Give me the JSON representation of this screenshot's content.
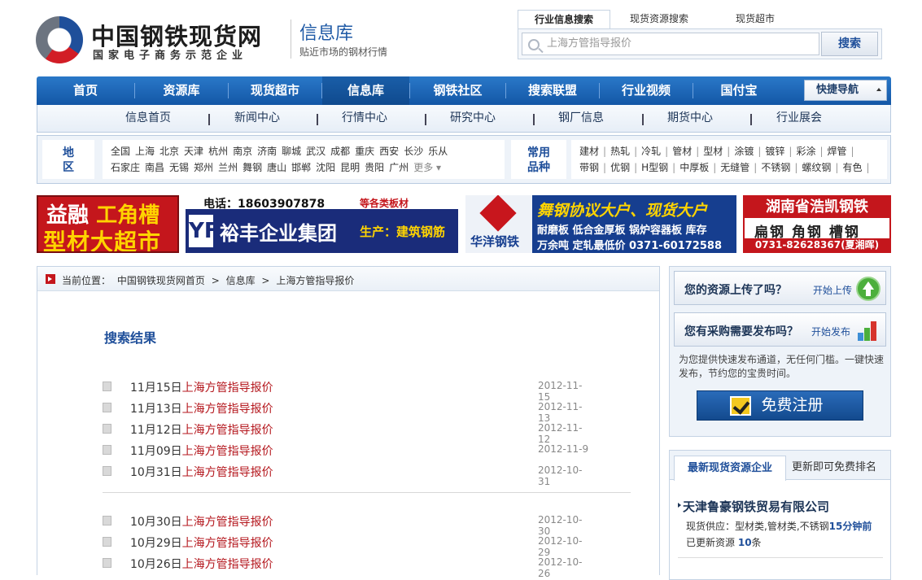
{
  "header": {
    "logo_main": "中国钢铁现货网",
    "logo_sub": "国家电子商务示范企业",
    "section_title": "信息库",
    "section_sub": "贴近市场的钢材行情",
    "search_tabs": [
      "行业信息搜索",
      "现货资源搜索",
      "现货超市"
    ],
    "search_placeholder": "上海方管指导报价",
    "search_button": "搜索"
  },
  "main_nav": {
    "items": [
      "首页",
      "资源库",
      "现货超市",
      "信息库",
      "钢铁社区",
      "搜索联盟",
      "行业视频",
      "国付宝"
    ],
    "active": "信息库",
    "quick_nav": "快捷导航"
  },
  "sub_nav": [
    "信息首页",
    "新闻中心",
    "行情中心",
    "研究中心",
    "钢厂信息",
    "期货中心",
    "行业展会"
  ],
  "filters": {
    "region_label": "地区",
    "regions_row1": [
      "全国",
      "上海",
      "北京",
      "天津",
      "杭州",
      "南京",
      "济南",
      "聊城",
      "武汉",
      "成都",
      "重庆",
      "西安",
      "长沙",
      "乐从"
    ],
    "regions_row2": [
      "石家庄",
      "南昌",
      "无锡",
      "郑州",
      "兰州",
      "舞钢",
      "唐山",
      "邯郸",
      "沈阳",
      "昆明",
      "贵阳",
      "广州"
    ],
    "more_label": "更多",
    "product_label": "常用品种",
    "products_row1": [
      "建材",
      "热轧",
      "冷轧",
      "管材",
      "型材",
      "涂镀",
      "镀锌",
      "彩涂",
      "焊管"
    ],
    "products_row2": [
      "带钢",
      "优钢",
      "H型钢",
      "中厚板",
      "无缝管",
      "不锈钢",
      "螺纹钢",
      "有色"
    ]
  },
  "ads": {
    "ad1_l1a": "益融",
    "ad1_l1b": "工角槽",
    "ad1_l2": "型材大超市",
    "ad2_phone": "电话：18603907878",
    "ad2_tag": "等各类板材",
    "ad2_mark": "YF",
    "ad2_name": "裕丰企业集团",
    "ad2_prod": "生产：建筑钢筋",
    "ad3_brand": "华洋钢铁",
    "ad3_head": "舞钢协议大户、现货大户",
    "ad3_r2": "耐磨板 低合金厚板 锅炉容器板 库存",
    "ad3_r3": "万余吨  定轧最低价 0371-60172588",
    "ad4_l1": "湖南省浩凯钢铁",
    "ad4_l2": "扁钢 角钢 槽钢",
    "ad4_l3": "0731-82628367(夏湘晖)"
  },
  "breadcrumb": {
    "prefix": "当前位置：",
    "items": [
      "中国钢铁现货网首页",
      ">",
      "信息库",
      ">",
      "上海方管指导报价"
    ]
  },
  "results": {
    "title": "搜索结果",
    "group1": [
      {
        "prefix": "11月15日",
        "title": "上海方管指导报价",
        "date": "2012-11-15"
      },
      {
        "prefix": "11月13日",
        "title": "上海方管指导报价",
        "date": "2012-11-13"
      },
      {
        "prefix": "11月12日",
        "title": "上海方管指导报价",
        "date": "2012-11-12"
      },
      {
        "prefix": "11月09日",
        "title": "上海方管指导报价",
        "date": "2012-11-9"
      },
      {
        "prefix": "10月31日",
        "title": "上海方管指导报价",
        "date": "2012-10-31"
      }
    ],
    "group2": [
      {
        "prefix": "10月30日",
        "title": "上海方管指导报价",
        "date": "2012-10-30"
      },
      {
        "prefix": "10月29日",
        "title": "上海方管指导报价",
        "date": "2012-10-29"
      },
      {
        "prefix": "10月26日",
        "title": "上海方管指导报价",
        "date": "2012-10-26"
      }
    ]
  },
  "sidebar": {
    "upload_text": "您的资源上传了吗？",
    "upload_action": "开始上传",
    "purchase_text": "您有采购需要发布吗？",
    "purchase_action": "开始发布",
    "desc": "为您提供快速发布通道，无任何门槛。一键快速发布，节约您的宝贵时间。",
    "register": "免费注册",
    "tab_active": "最新现货资源企业",
    "tab_other": "更新即可免费排名",
    "company": "天津鲁豪钢铁贸易有限公司",
    "supply_label": "现货供应：型材类,管材类,不锈钢",
    "supply_time": "15分钟前",
    "updated_label": "已更新资源",
    "updated_count": "10",
    "updated_unit": "条"
  },
  "colors": {
    "nav_blue": "#1357a6",
    "link_red": "#b4161c",
    "title_blue": "#1f4f9a"
  }
}
